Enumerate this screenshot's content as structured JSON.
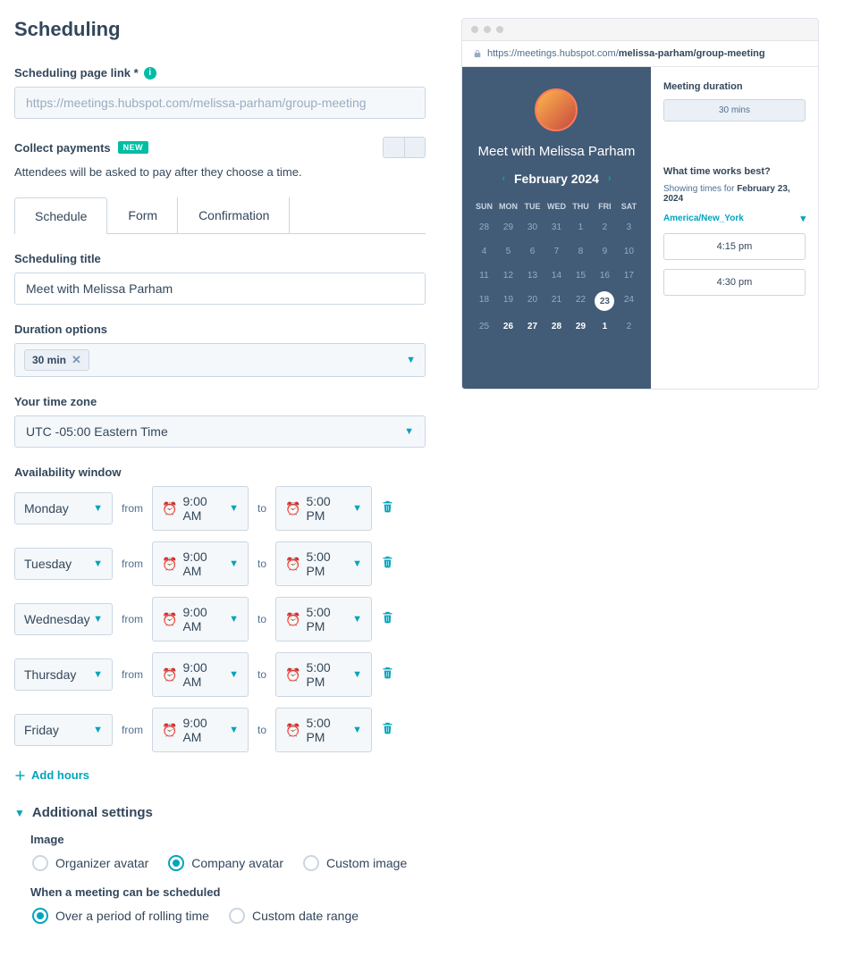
{
  "page": {
    "title": "Scheduling"
  },
  "link_field": {
    "label": "Scheduling page link *",
    "value": "https://meetings.hubspot.com/melissa-parham/group-meeting"
  },
  "payments": {
    "label": "Collect payments",
    "badge": "NEW",
    "helper": "Attendees will be asked to pay after they choose a time."
  },
  "tabs": [
    {
      "label": "Schedule",
      "active": true
    },
    {
      "label": "Form",
      "active": false
    },
    {
      "label": "Confirmation",
      "active": false
    }
  ],
  "sched_title": {
    "label": "Scheduling title",
    "value": "Meet with Melissa Parham"
  },
  "duration": {
    "label": "Duration options",
    "chip": "30 min"
  },
  "timezone": {
    "label": "Your time zone",
    "value": "UTC -05:00 Eastern Time"
  },
  "availability": {
    "label": "Availability window",
    "from_txt": "from",
    "to_txt": "to",
    "rows": [
      {
        "day": "Monday",
        "start": "9:00 AM",
        "end": "5:00 PM"
      },
      {
        "day": "Tuesday",
        "start": "9:00 AM",
        "end": "5:00 PM"
      },
      {
        "day": "Wednesday",
        "start": "9:00 AM",
        "end": "5:00 PM"
      },
      {
        "day": "Thursday",
        "start": "9:00 AM",
        "end": "5:00 PM"
      },
      {
        "day": "Friday",
        "start": "9:00 AM",
        "end": "5:00 PM"
      }
    ],
    "add_hours": "Add hours"
  },
  "additional": {
    "header": "Additional settings",
    "image_label": "Image",
    "image_options": [
      "Organizer avatar",
      "Company avatar",
      "Custom image"
    ],
    "image_selected": 1,
    "when_label": "When a meeting can be scheduled",
    "when_options": [
      "Over a period of rolling time",
      "Custom date range"
    ],
    "when_selected": 0
  },
  "preview": {
    "url_prefix": "https://meetings.hubspot.com/",
    "url_bold": "melissa-parham/group-meeting",
    "meet_title": "Meet with Melissa Parham",
    "month": "February 2024",
    "dow": [
      "SUN",
      "MON",
      "TUE",
      "WED",
      "THU",
      "FRI",
      "SAT"
    ],
    "grid": [
      [
        {
          "n": 28
        },
        {
          "n": 29
        },
        {
          "n": 30
        },
        {
          "n": 31
        },
        {
          "n": 1
        },
        {
          "n": 2
        },
        {
          "n": 3
        }
      ],
      [
        {
          "n": 4
        },
        {
          "n": 5
        },
        {
          "n": 6
        },
        {
          "n": 7
        },
        {
          "n": 8
        },
        {
          "n": 9
        },
        {
          "n": 10
        }
      ],
      [
        {
          "n": 11
        },
        {
          "n": 12
        },
        {
          "n": 13
        },
        {
          "n": 14
        },
        {
          "n": 15
        },
        {
          "n": 16
        },
        {
          "n": 17
        }
      ],
      [
        {
          "n": 18
        },
        {
          "n": 19
        },
        {
          "n": 20
        },
        {
          "n": 21
        },
        {
          "n": 22
        },
        {
          "n": 23,
          "sel": true
        },
        {
          "n": 24
        }
      ],
      [
        {
          "n": 25
        },
        {
          "n": 26,
          "b": true
        },
        {
          "n": 27,
          "b": true
        },
        {
          "n": 28,
          "b": true
        },
        {
          "n": 29,
          "b": true
        },
        {
          "n": 1,
          "b": true
        },
        {
          "n": 2
        }
      ]
    ],
    "dur_label": "Meeting duration",
    "dur_btn": "30 mins",
    "what_time": "What time works best?",
    "showing_prefix": "Showing times for ",
    "showing_date": "February 23, 2024",
    "tz": "America/New_York",
    "slots": [
      "4:15 pm",
      "4:30 pm"
    ]
  }
}
